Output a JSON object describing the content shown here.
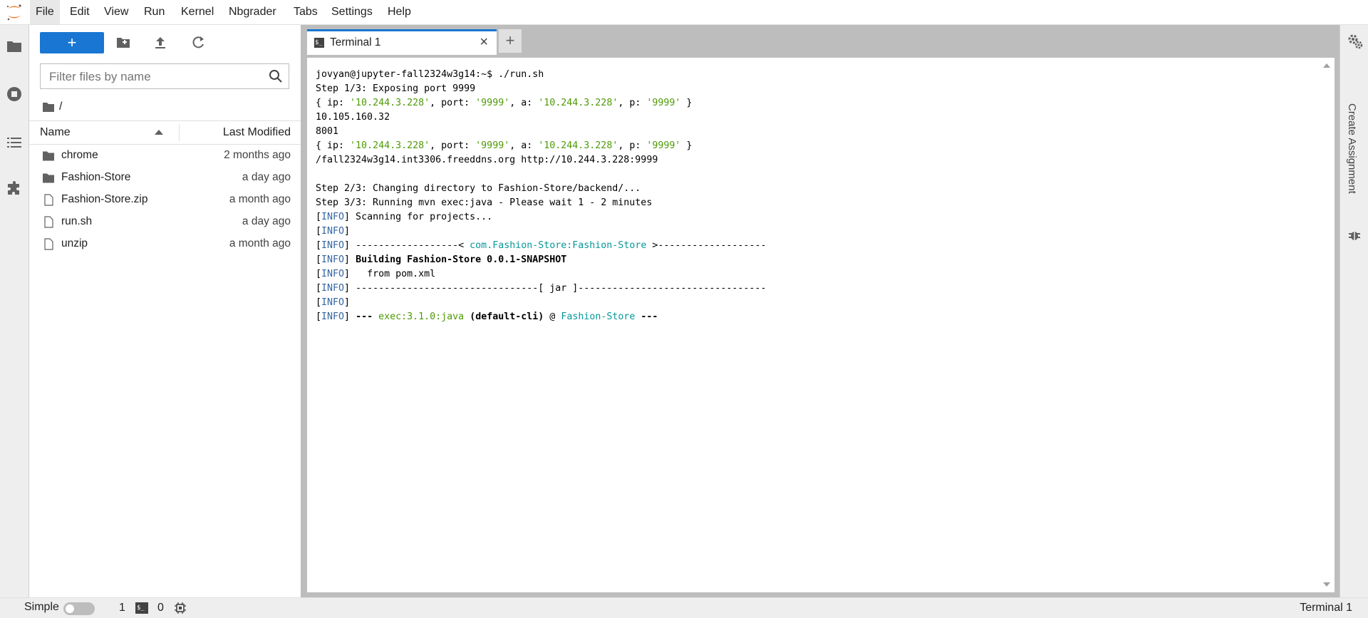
{
  "menubar": {
    "logo": "jupyter-logo-icon",
    "items": [
      "File",
      "Edit",
      "View",
      "Run",
      "Kernel",
      "Nbgrader",
      "Tabs",
      "Settings",
      "Help"
    ]
  },
  "leftbar": {
    "icons": [
      "folder-icon",
      "running-sessions-icon",
      "table-of-contents-icon",
      "extension-icon"
    ]
  },
  "filebrowser": {
    "new_label": "+",
    "toolbar_icons": [
      "new-folder-icon",
      "upload-icon",
      "refresh-icon"
    ],
    "filter_placeholder": "Filter files by name",
    "breadcrumb": "/",
    "col_name": "Name",
    "col_modified": "Last Modified",
    "files": [
      {
        "name": "chrome",
        "modified": "2 months ago",
        "type": "folder"
      },
      {
        "name": "Fashion-Store",
        "modified": "a day ago",
        "type": "folder"
      },
      {
        "name": "Fashion-Store.zip",
        "modified": "a month ago",
        "type": "file"
      },
      {
        "name": "run.sh",
        "modified": "a day ago",
        "type": "file"
      },
      {
        "name": "unzip",
        "modified": "a month ago",
        "type": "file"
      }
    ]
  },
  "tabs": {
    "active_label": "Terminal 1",
    "active_icon": "$_",
    "close": "×",
    "add": "+"
  },
  "terminal": {
    "lines": [
      [
        {
          "t": "jovyan@jupyter-fall2324w3g14:~$ ./run.sh"
        }
      ],
      [
        {
          "t": "Step 1/3: Exposing port 9999"
        }
      ],
      [
        {
          "t": "{ ip: "
        },
        {
          "t": "'10.244.3.228'",
          "c": "g"
        },
        {
          "t": ", port: "
        },
        {
          "t": "'9999'",
          "c": "g"
        },
        {
          "t": ", a: "
        },
        {
          "t": "'10.244.3.228'",
          "c": "g"
        },
        {
          "t": ", p: "
        },
        {
          "t": "'9999'",
          "c": "g"
        },
        {
          "t": " }"
        }
      ],
      [
        {
          "t": "10.105.160.32"
        }
      ],
      [
        {
          "t": "8001"
        }
      ],
      [
        {
          "t": "{ ip: "
        },
        {
          "t": "'10.244.3.228'",
          "c": "g"
        },
        {
          "t": ", port: "
        },
        {
          "t": "'9999'",
          "c": "g"
        },
        {
          "t": ", a: "
        },
        {
          "t": "'10.244.3.228'",
          "c": "g"
        },
        {
          "t": ", p: "
        },
        {
          "t": "'9999'",
          "c": "g"
        },
        {
          "t": " }"
        }
      ],
      [
        {
          "t": "/fall2324w3g14.int3306.freeddns.org http://10.244.3.228:9999"
        }
      ],
      [
        {
          "t": ""
        }
      ],
      [
        {
          "t": "Step 2/3: Changing directory to Fashion-Store/backend/..."
        }
      ],
      [
        {
          "t": "Step 3/3: Running mvn exec:java - Please wait 1 - 2 minutes"
        }
      ],
      [
        {
          "t": "["
        },
        {
          "t": "INFO",
          "c": "b"
        },
        {
          "t": "] Scanning for projects..."
        }
      ],
      [
        {
          "t": "["
        },
        {
          "t": "INFO",
          "c": "b"
        },
        {
          "t": "]"
        }
      ],
      [
        {
          "t": "["
        },
        {
          "t": "INFO",
          "c": "b"
        },
        {
          "t": "] ------------------< "
        },
        {
          "t": "com.Fashion-Store:Fashion-Store",
          "c": "c"
        },
        {
          "t": " >-------------------"
        }
      ],
      [
        {
          "t": "["
        },
        {
          "t": "INFO",
          "c": "b"
        },
        {
          "t": "] "
        },
        {
          "t": "Building Fashion-Store 0.0.1-SNAPSHOT",
          "c": "bold"
        }
      ],
      [
        {
          "t": "["
        },
        {
          "t": "INFO",
          "c": "b"
        },
        {
          "t": "]   from pom.xml"
        }
      ],
      [
        {
          "t": "["
        },
        {
          "t": "INFO",
          "c": "b"
        },
        {
          "t": "] --------------------------------[ jar ]---------------------------------"
        }
      ],
      [
        {
          "t": "["
        },
        {
          "t": "INFO",
          "c": "b"
        },
        {
          "t": "]"
        }
      ],
      [
        {
          "t": "["
        },
        {
          "t": "INFO",
          "c": "b"
        },
        {
          "t": "] "
        },
        {
          "t": "---",
          "c": "bold"
        },
        {
          "t": " "
        },
        {
          "t": "exec:3.1.0:java",
          "c": "g"
        },
        {
          "t": " "
        },
        {
          "t": "(default-cli)",
          "c": "bold"
        },
        {
          "t": " @ "
        },
        {
          "t": "Fashion-Store",
          "c": "c"
        },
        {
          "t": " "
        },
        {
          "t": "---",
          "c": "bold"
        }
      ]
    ]
  },
  "rightbar": {
    "icons": [
      "property-inspector-icon",
      "debugger-icon"
    ],
    "label": "Create Assignment"
  },
  "statusbar": {
    "simple_label": "Simple",
    "simple_mode_on": false,
    "count_one": "1",
    "terminal_icon": "$_",
    "count_zero": "0",
    "right_label": "Terminal 1"
  },
  "colors": {
    "accent": "#1976d2",
    "logo": "#f37726",
    "terminal_green": "#4e9a06",
    "terminal_cyan": "#06989a",
    "terminal_blue": "#3465a4"
  }
}
